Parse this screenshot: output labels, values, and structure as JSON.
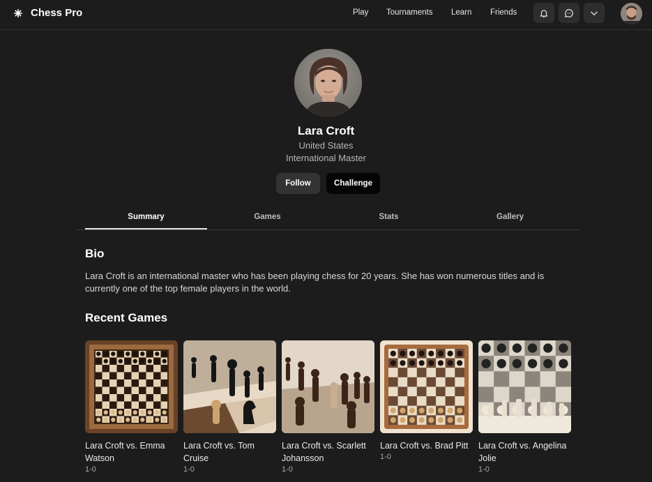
{
  "header": {
    "brand": "Chess Pro",
    "nav": [
      {
        "label": "Play"
      },
      {
        "label": "Tournaments"
      },
      {
        "label": "Learn"
      },
      {
        "label": "Friends"
      }
    ],
    "icons": [
      "bell-icon",
      "chat-icon",
      "chevron-down-icon"
    ]
  },
  "profile": {
    "name": "Lara Croft",
    "country": "United States",
    "title": "International Master",
    "follow_label": "Follow",
    "challenge_label": "Challenge"
  },
  "tabs": [
    {
      "label": "Summary",
      "active": true
    },
    {
      "label": "Games",
      "active": false
    },
    {
      "label": "Stats",
      "active": false
    },
    {
      "label": "Gallery",
      "active": false
    }
  ],
  "bio": {
    "heading": "Bio",
    "text": "Lara Croft is an international master who has been playing chess for 20 years. She has won numerous titles and is currently one of the top female players in the world."
  },
  "recent_games": {
    "heading": "Recent Games",
    "items": [
      {
        "title": "Lara Croft vs. Emma Watson",
        "result": "1-0"
      },
      {
        "title": "Lara Croft vs. Tom Cruise",
        "result": "1-0"
      },
      {
        "title": "Lara Croft vs. Scarlett Johansson",
        "result": "1-0"
      },
      {
        "title": "Lara Croft vs. Brad Pitt",
        "result": "1-0"
      },
      {
        "title": "Lara Croft vs. Angelina Jolie",
        "result": "1-0"
      }
    ]
  },
  "colors": {
    "background": "#1c1c1c",
    "button_dark": "#050505",
    "button_gray": "#333333",
    "text_muted": "#b8b8b8"
  }
}
